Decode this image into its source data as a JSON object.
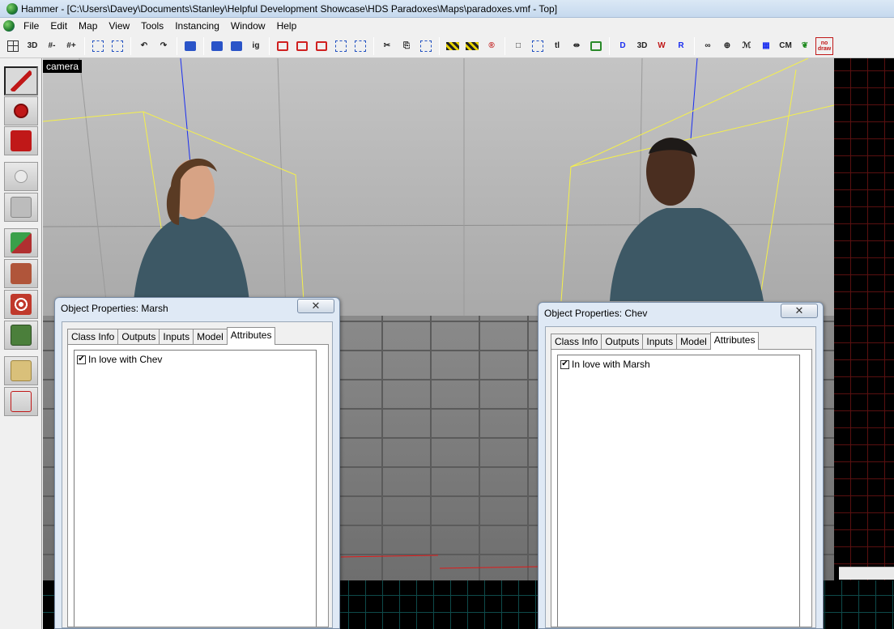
{
  "window": {
    "title": "Hammer - [C:\\Users\\Davey\\Documents\\Stanley\\Helpful Development Showcase\\HDS Paradoxes\\Maps\\paradoxes.vmf - Top]"
  },
  "menu": [
    "File",
    "Edit",
    "Map",
    "View",
    "Tools",
    "Instancing",
    "Window",
    "Help"
  ],
  "toolbar": {
    "buttons": [
      {
        "name": "grid-icon",
        "text": ""
      },
      {
        "name": "grid-3d-icon",
        "text": "3D"
      },
      {
        "name": "grid-smaller-icon",
        "text": "#-"
      },
      {
        "name": "grid-larger-icon",
        "text": "#+"
      },
      {
        "name": "group-icon",
        "text": ""
      },
      {
        "name": "ungroup-icon",
        "text": ""
      },
      {
        "name": "undo-icon",
        "text": "↶"
      },
      {
        "name": "redo-icon",
        "text": "↷"
      },
      {
        "name": "carve-icon",
        "text": ""
      },
      {
        "name": "selection-icon",
        "text": ""
      },
      {
        "name": "hide-icon",
        "text": ""
      },
      {
        "name": "ig-icon",
        "text": "ig"
      },
      {
        "name": "cut-icon",
        "text": "✂"
      },
      {
        "name": "copy-icon",
        "text": "⎘"
      },
      {
        "name": "paste-icon",
        "text": "📋"
      },
      {
        "name": "texture-lock-icon",
        "text": ""
      },
      {
        "name": "cordon-icon",
        "text": ""
      },
      {
        "name": "radius-icon",
        "text": "®"
      },
      {
        "name": "select-box-icon",
        "text": "□"
      },
      {
        "name": "tl-icon",
        "text": "tl"
      },
      {
        "name": "flip-icon",
        "text": "⇹"
      },
      {
        "name": "vertex-icon",
        "text": ""
      },
      {
        "name": "solid-icon",
        "text": "D"
      },
      {
        "name": "path-icon",
        "text": "3D"
      },
      {
        "name": "wireframe-icon",
        "text": "W"
      },
      {
        "name": "textured-icon",
        "text": "R"
      },
      {
        "name": "link-icon",
        "text": "∞"
      },
      {
        "name": "target-icon",
        "text": "⊕"
      },
      {
        "name": "lightmap-icon",
        "text": "ℳ"
      },
      {
        "name": "overlay-icon",
        "text": "▦"
      },
      {
        "name": "cm-icon",
        "text": "CM"
      },
      {
        "name": "leaf-icon",
        "text": "❦"
      },
      {
        "name": "nodraw-icon",
        "text": "no draw"
      }
    ]
  },
  "tools": [
    {
      "name": "selection-tool",
      "color": "#c01818"
    },
    {
      "name": "magnify-tool",
      "color": "#c01818"
    },
    {
      "name": "camera-tool",
      "color": "#c01818"
    },
    {
      "name": "entity-tool",
      "color": "#dadada"
    },
    {
      "name": "block-tool",
      "color": "#bcbcbc"
    },
    {
      "name": "texture-application-tool",
      "color": "#4a8a3a"
    },
    {
      "name": "apply-texture-tool",
      "color": "#b0553a"
    },
    {
      "name": "decal-tool",
      "color": "#c0392b"
    },
    {
      "name": "overlay-tool",
      "color": "#4b7f3b"
    },
    {
      "name": "clipping-tool",
      "color": "#d9c07a"
    },
    {
      "name": "vertex-tool",
      "color": "#c0c0c0"
    }
  ],
  "viewport": {
    "camera_label": "camera"
  },
  "dialogs": [
    {
      "title": "Object Properties: Marsh",
      "tabs": [
        "Class Info",
        "Outputs",
        "Inputs",
        "Model",
        "Attributes"
      ],
      "active_tab": "Attributes",
      "attribute": {
        "label": "In love with Chev",
        "checked": "✔"
      }
    },
    {
      "title": "Object Properties: Chev",
      "tabs": [
        "Class Info",
        "Outputs",
        "Inputs",
        "Model",
        "Attributes"
      ],
      "active_tab": "Attributes",
      "attribute": {
        "label": "In love with Marsh",
        "checked": "✔"
      }
    }
  ],
  "close_glyph": "✕",
  "colors": {
    "wireframe": "#f5f04a",
    "axis_z": "#1a2ef0",
    "axis_x": "#e21a1a",
    "grid_2d": "#5a1010"
  }
}
